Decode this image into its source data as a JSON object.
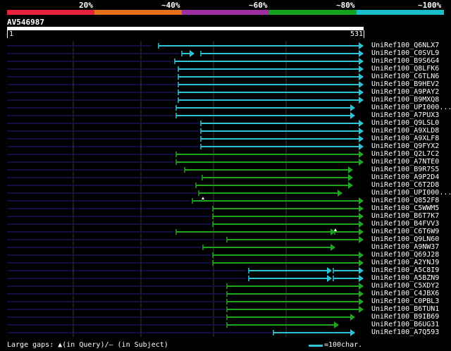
{
  "legend": [
    {
      "label": "20%",
      "color": "#e8213a",
      "pct": "20"
    },
    {
      "label": "~40%",
      "color": "#e66f19",
      "pct": "40"
    },
    {
      "label": "~60%",
      "color": "#9b2fa0",
      "pct": "60"
    },
    {
      "label": "~80%",
      "color": "#15a31d",
      "pct": "80"
    },
    {
      "label": "~100%",
      "color": "#16bfc9",
      "pct": "100"
    }
  ],
  "query": {
    "id": "AV546987",
    "start": "1",
    "end": "531",
    "length": 531
  },
  "hits": [
    {
      "id": "UniRef100_Q6NLX7",
      "color": "cyan",
      "segs": [
        [
          0,
          205,
          false
        ],
        [
          215,
          505,
          true
        ]
      ]
    },
    {
      "id": "UniRef100_C0SVL9",
      "color": "cyan",
      "segs": [
        [
          0,
          245,
          false
        ],
        [
          248,
          265,
          true
        ],
        [
          275,
          505,
          true
        ]
      ]
    },
    {
      "id": "UniRef100_B9S6G4",
      "color": "cyan",
      "segs": [
        [
          0,
          235,
          false
        ],
        [
          238,
          505,
          true
        ]
      ]
    },
    {
      "id": "UniRef100_Q8LFK6",
      "color": "cyan",
      "segs": [
        [
          0,
          240,
          false
        ],
        [
          243,
          505,
          true
        ]
      ]
    },
    {
      "id": "UniRef100_C6TLN6",
      "color": "cyan",
      "segs": [
        [
          0,
          240,
          false
        ],
        [
          243,
          505,
          true
        ]
      ]
    },
    {
      "id": "UniRef100_B9HEV2",
      "color": "cyan",
      "segs": [
        [
          0,
          240,
          false
        ],
        [
          243,
          505,
          true
        ]
      ]
    },
    {
      "id": "UniRef100_A9PAY2",
      "color": "cyan",
      "segs": [
        [
          0,
          240,
          false
        ],
        [
          243,
          505,
          true
        ]
      ]
    },
    {
      "id": "UniRef100_B9MXQ8",
      "color": "cyan",
      "segs": [
        [
          0,
          240,
          false
        ],
        [
          243,
          505,
          true
        ]
      ]
    },
    {
      "id": "UniRef100_UPI000...",
      "color": "cyan",
      "segs": [
        [
          0,
          237,
          false
        ],
        [
          240,
          493,
          true
        ]
      ]
    },
    {
      "id": "UniRef100_A7PUX3",
      "color": "cyan",
      "segs": [
        [
          0,
          237,
          false
        ],
        [
          240,
          493,
          true
        ]
      ]
    },
    {
      "id": "UniRef100_Q9LSL0",
      "color": "cyan",
      "segs": [
        [
          0,
          272,
          false
        ],
        [
          275,
          505,
          true
        ]
      ]
    },
    {
      "id": "UniRef100_A9XLD8",
      "color": "cyan",
      "segs": [
        [
          0,
          272,
          false
        ],
        [
          275,
          505,
          true
        ]
      ]
    },
    {
      "id": "UniRef100_A9XLF8",
      "color": "cyan",
      "segs": [
        [
          0,
          272,
          false
        ],
        [
          275,
          505,
          true
        ]
      ]
    },
    {
      "id": "UniRef100_Q9FYX2",
      "color": "cyan",
      "segs": [
        [
          0,
          272,
          false
        ],
        [
          275,
          505,
          true
        ]
      ]
    },
    {
      "id": "UniRef100_Q2L7C2",
      "color": "green",
      "segs": [
        [
          0,
          237,
          false
        ],
        [
          240,
          505,
          true
        ]
      ]
    },
    {
      "id": "UniRef100_A7NTE0",
      "color": "green",
      "segs": [
        [
          0,
          237,
          false
        ],
        [
          240,
          505,
          true
        ]
      ]
    },
    {
      "id": "UniRef100_B9R7S5",
      "color": "green",
      "segs": [
        [
          0,
          250,
          false
        ],
        [
          252,
          490,
          true
        ]
      ]
    },
    {
      "id": "UniRef100_A9P2D4",
      "color": "green",
      "segs": [
        [
          0,
          275,
          false
        ],
        [
          277,
          490,
          true
        ]
      ]
    },
    {
      "id": "UniRef100_C6T2D8",
      "color": "green",
      "segs": [
        [
          0,
          265,
          false
        ],
        [
          268,
          490,
          true
        ]
      ]
    },
    {
      "id": "UniRef100_UPI000...",
      "color": "green",
      "segs": [
        [
          0,
          270,
          false
        ],
        [
          272,
          475,
          true
        ]
      ],
      "gap": [
        278,
        7
      ]
    },
    {
      "id": "UniRef100_Q852F8",
      "color": "green",
      "segs": [
        [
          0,
          260,
          false
        ],
        [
          263,
          505,
          true
        ]
      ]
    },
    {
      "id": "UniRef100_C5WWM5",
      "color": "green",
      "segs": [
        [
          0,
          290,
          false
        ],
        [
          292,
          505,
          true
        ]
      ]
    },
    {
      "id": "UniRef100_B6T7K7",
      "color": "green",
      "segs": [
        [
          0,
          290,
          false
        ],
        [
          292,
          505,
          true
        ]
      ]
    },
    {
      "id": "UniRef100_B4FVV3",
      "color": "green",
      "segs": [
        [
          0,
          290,
          false
        ],
        [
          292,
          505,
          true
        ]
      ]
    },
    {
      "id": "UniRef100_C6T6W9",
      "color": "green",
      "segs": [
        [
          0,
          237,
          false
        ],
        [
          240,
          465,
          true
        ],
        [
          465,
          505,
          true
        ]
      ],
      "gap": [
        466,
        -3
      ]
    },
    {
      "id": "UniRef100_Q9LN60",
      "color": "green",
      "segs": [
        [
          0,
          310,
          false
        ],
        [
          312,
          505,
          true
        ]
      ]
    },
    {
      "id": "UniRef100_A9NW37",
      "color": "green",
      "segs": [
        [
          0,
          275,
          false
        ],
        [
          278,
          465,
          true
        ]
      ]
    },
    {
      "id": "UniRef100_Q69J28",
      "color": "green",
      "segs": [
        [
          0,
          290,
          false
        ],
        [
          292,
          505,
          true
        ]
      ]
    },
    {
      "id": "UniRef100_A2YNJ9",
      "color": "green",
      "segs": [
        [
          0,
          290,
          false
        ],
        [
          292,
          505,
          true
        ]
      ]
    },
    {
      "id": "UniRef100_A5C8I9",
      "color": "cyan",
      "segs": [
        [
          0,
          340,
          false
        ],
        [
          343,
          460,
          true
        ],
        [
          463,
          505,
          true
        ]
      ]
    },
    {
      "id": "UniRef100_A5BZN9",
      "color": "cyan",
      "segs": [
        [
          0,
          340,
          false
        ],
        [
          343,
          460,
          true
        ],
        [
          463,
          505,
          true
        ]
      ]
    },
    {
      "id": "UniRef100_C5XDY2",
      "color": "green",
      "segs": [
        [
          0,
          310,
          false
        ],
        [
          312,
          505,
          true
        ]
      ]
    },
    {
      "id": "UniRef100_C4JBX6",
      "color": "green",
      "segs": [
        [
          0,
          310,
          false
        ],
        [
          312,
          505,
          true
        ]
      ]
    },
    {
      "id": "UniRef100_C0PBL3",
      "color": "green",
      "segs": [
        [
          0,
          310,
          false
        ],
        [
          312,
          505,
          true
        ]
      ]
    },
    {
      "id": "UniRef100_B6TUN1",
      "color": "green",
      "segs": [
        [
          0,
          310,
          false
        ],
        [
          312,
          505,
          true
        ]
      ]
    },
    {
      "id": "UniRef100_B9IB69",
      "color": "green",
      "segs": [
        [
          0,
          310,
          false
        ],
        [
          312,
          493,
          true
        ]
      ]
    },
    {
      "id": "UniRef100_B6UG31",
      "color": "green",
      "segs": [
        [
          0,
          310,
          false
        ],
        [
          312,
          470,
          true
        ]
      ]
    },
    {
      "id": "UniRef100_A7Q593",
      "color": "cyan",
      "segs": [
        [
          0,
          375,
          false
        ],
        [
          378,
          493,
          true
        ]
      ]
    }
  ],
  "footer": {
    "gaps_text": "Large gaps: ▲(in Query)/– (in Subject)",
    "scale_text": "=100char."
  },
  "colors": {
    "cyan": "#2bc3d6",
    "green": "#1ea51e",
    "navy": "#14145a",
    "grid": "#3a3a3a"
  }
}
